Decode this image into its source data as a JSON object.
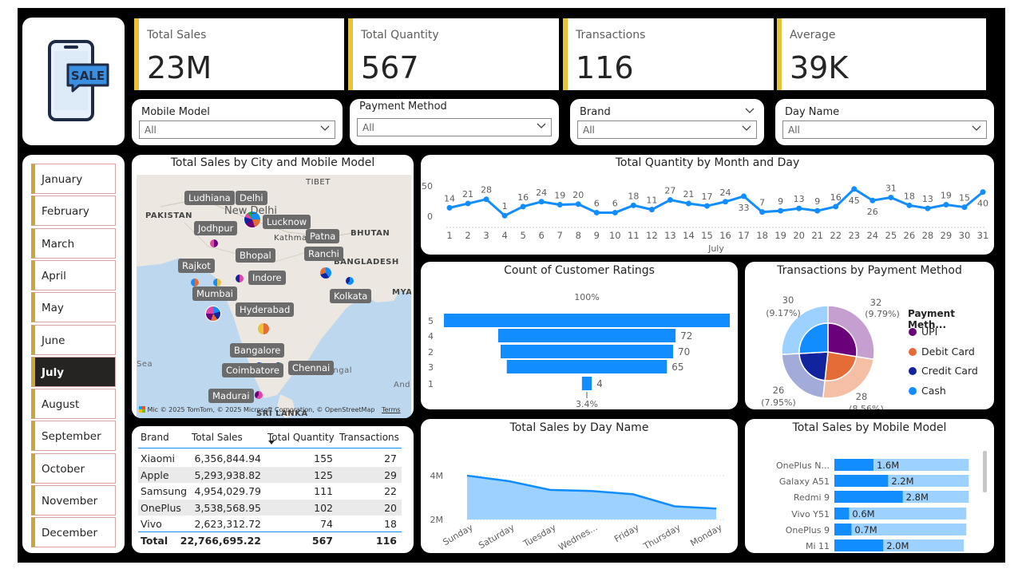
{
  "kpis": [
    {
      "label": "Total Sales",
      "value": "23M"
    },
    {
      "label": "Total Quantity",
      "value": "567"
    },
    {
      "label": "Transactions",
      "value": "116"
    },
    {
      "label": "Average",
      "value": "39K"
    }
  ],
  "logo": {
    "text": "SALE"
  },
  "slicers": [
    {
      "label": "Mobile Model",
      "value": "All"
    },
    {
      "label": "Payment Method",
      "value": "All"
    },
    {
      "label": "Brand",
      "value": "All"
    },
    {
      "label": "Day Name",
      "value": "All"
    }
  ],
  "months": [
    "January",
    "February",
    "March",
    "April",
    "May",
    "June",
    "July",
    "August",
    "September",
    "October",
    "November",
    "December"
  ],
  "selected_month": "July",
  "map": {
    "title": "Total Sales by City and Mobile Model",
    "cities": [
      "Ludhiana",
      "Delhi",
      "New Delhi",
      "Lucknow",
      "Jodhpur",
      "Patna",
      "Ranchi",
      "Rajkot",
      "Bhopal",
      "Indore",
      "Mumbai",
      "Kolkata",
      "Hyderabad",
      "Bangalore",
      "Coimbatore",
      "Chennai",
      "Madurai"
    ],
    "regions": [
      "TIBET",
      "PAKISTAN",
      "BHUTAN",
      "BANGLADESH",
      "MYA",
      "SRI LANKA",
      "Sea",
      "Bay of Bengal",
      "And",
      "Kathmandu"
    ],
    "copyright": "© 2025 TomTom, © 2025 Microsoft Corporation, © OpenStreetMap",
    "terms": "Terms",
    "ms": "Mic"
  },
  "table": {
    "headers": [
      "Brand",
      "Total Sales",
      "Total Quantity",
      "Transactions"
    ],
    "rows": [
      [
        "Xiaomi",
        "6,356,844.94",
        "155",
        "27"
      ],
      [
        "Apple",
        "5,293,938.82",
        "125",
        "29"
      ],
      [
        "Samsung",
        "4,954,029.79",
        "111",
        "22"
      ],
      [
        "OnePlus",
        "3,538,568.95",
        "102",
        "20"
      ],
      [
        "Vivo",
        "2,623,312.72",
        "74",
        "18"
      ]
    ],
    "total": [
      "Total",
      "22,766,695.22",
      "567",
      "116"
    ]
  },
  "colors": {
    "accent_blue": "#118dff",
    "kpi_bar": "#e7c23a",
    "light_blue": "#9dd1ff"
  },
  "chart_data": [
    {
      "type": "line",
      "title": "Total Quantity by Month and Day",
      "xlabel": "July",
      "x": [
        "1",
        "2",
        "3",
        "4",
        "5",
        "6",
        "7",
        "8",
        "9",
        "10",
        "11",
        "12",
        "13",
        "14",
        "15",
        "16",
        "17",
        "18",
        "19",
        "20",
        "21",
        "22",
        "23",
        "24",
        "25",
        "26",
        "28",
        "29",
        "30",
        "31"
      ],
      "values": [
        14,
        21,
        28,
        1,
        16,
        24,
        19,
        20,
        6,
        6,
        18,
        11,
        27,
        21,
        17,
        24,
        33,
        7,
        9,
        13,
        9,
        16,
        45,
        26,
        31,
        18,
        13,
        19,
        15,
        40
      ],
      "y_ticks": [
        0,
        50
      ]
    },
    {
      "type": "bar",
      "title": "Count of Customer Ratings",
      "categories": [
        "5",
        "4",
        "2",
        "3",
        "1"
      ],
      "values": [
        116,
        72,
        70,
        65,
        4
      ],
      "top_label": "100%",
      "bottom_label": "3.4%"
    },
    {
      "type": "pie",
      "title": "Transactions by Payment Method",
      "legend_title": "Payment Meth...",
      "labels": [
        "UPI",
        "Debit Card",
        "Credit Card",
        "Cash"
      ],
      "values": [
        32,
        28,
        26,
        30
      ],
      "pct": [
        "(9.79%)",
        "(8.56%)",
        "(7.95%)",
        "(9.17%)"
      ],
      "colors": [
        "#6b007b",
        "#e66c37",
        "#12239e",
        "#118dff"
      ]
    },
    {
      "type": "area",
      "title": "Total Sales by Day Name",
      "categories": [
        "Sunday",
        "Saturday",
        "Tuesday",
        "Wednes...",
        "Friday",
        "Thursday",
        "Monday"
      ],
      "values": [
        4.0,
        3.75,
        3.35,
        3.3,
        3.15,
        2.6,
        2.5
      ],
      "y_ticks": [
        "2M",
        "4M"
      ],
      "ylim": [
        2,
        4
      ]
    },
    {
      "type": "bar",
      "title": "Total Sales by Mobile Model",
      "categories": [
        "OnePlus N...",
        "Galaxy A51",
        "Redmi 9",
        "Vivo Y51",
        "OnePlus 9",
        "Mi 11"
      ],
      "values": [
        1.6,
        2.2,
        2.8,
        0.6,
        0.7,
        2.0
      ],
      "labels": [
        "1.6M",
        "2.2M",
        "2.8M",
        "0.6M",
        "0.7M",
        "2.0M"
      ],
      "totals": [
        5.5,
        5.5,
        5.5,
        5.4,
        5.4,
        5.3
      ]
    }
  ]
}
